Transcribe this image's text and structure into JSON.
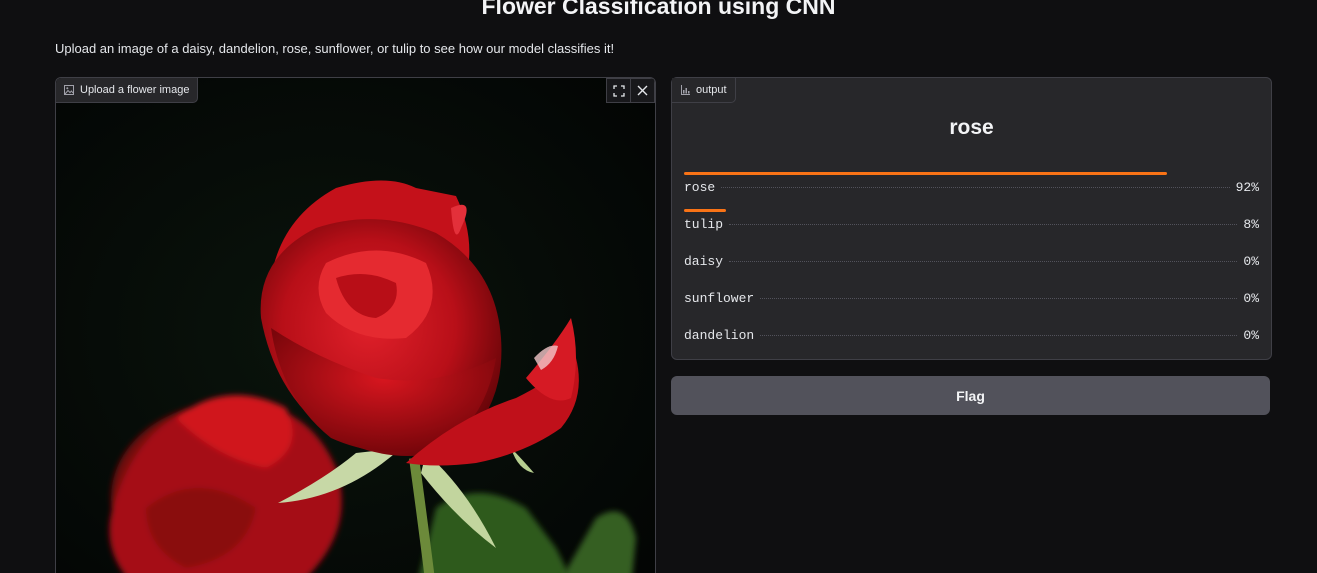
{
  "page": {
    "title": "Flower Classification using CNN",
    "description": "Upload an image of a daisy, dandelion, rose, sunflower, or tulip to see how our model classifies it!"
  },
  "input": {
    "label": "Upload a flower image",
    "label_icon": "image-icon",
    "actions": [
      {
        "name": "fullscreen",
        "icon": "fullscreen-icon"
      },
      {
        "name": "clear",
        "icon": "close-icon"
      }
    ]
  },
  "output": {
    "label": "output",
    "label_icon": "bar-chart-icon",
    "prediction": "rose",
    "confidences": [
      {
        "label": "rose",
        "value": 0.92,
        "display": "92%"
      },
      {
        "label": "tulip",
        "value": 0.08,
        "display": "8%"
      },
      {
        "label": "daisy",
        "value": 0.0,
        "display": "0%"
      },
      {
        "label": "sunflower",
        "value": 0.0,
        "display": "0%"
      },
      {
        "label": "dandelion",
        "value": 0.0,
        "display": "0%"
      }
    ]
  },
  "flag_button": {
    "label": "Flag"
  },
  "colors": {
    "accent": "#f97316",
    "panel": "#27272a",
    "button": "#52525b",
    "background": "#0f0f11"
  }
}
